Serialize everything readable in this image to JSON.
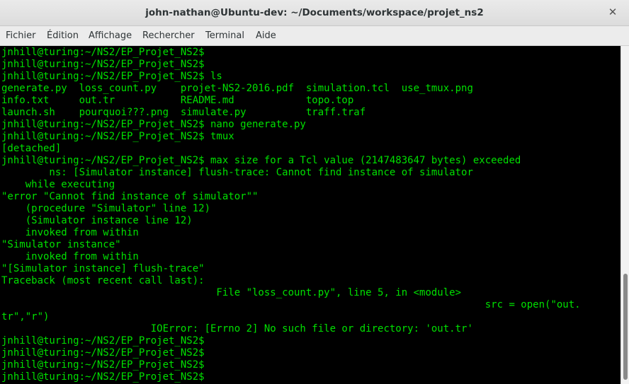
{
  "window": {
    "title": "john-nathan@Ubuntu-dev: ~/Documents/workspace/projet_ns2",
    "close_glyph": "✕"
  },
  "menu": [
    "Fichier",
    "Édition",
    "Affichage",
    "Rechercher",
    "Terminal",
    "Aide"
  ],
  "terminal": {
    "lines": [
      "jnhill@turing:~/NS2/EP_Projet_NS2$",
      "jnhill@turing:~/NS2/EP_Projet_NS2$",
      "jnhill@turing:~/NS2/EP_Projet_NS2$ ls",
      "generate.py  loss_count.py    projet-NS2-2016.pdf  simulation.tcl  use_tmux.png",
      "info.txt     out.tr           README.md            topo.top",
      "launch.sh    pourquoi???.png  simulate.py          traff.traf",
      "jnhill@turing:~/NS2/EP_Projet_NS2$ nano generate.py",
      "jnhill@turing:~/NS2/EP_Projet_NS2$ tmux",
      "[detached]",
      "jnhill@turing:~/NS2/EP_Projet_NS2$ max size for a Tcl value (2147483647 bytes) exceeded",
      "        ns: [Simulator instance] flush-trace: Cannot find instance of simulator",
      "    while executing",
      "\"error \"Cannot find instance of simulator\"\"",
      "    (procedure \"Simulator\" line 12)",
      "    (Simulator instance line 12)",
      "    invoked from within",
      "\"Simulator instance\"",
      "    invoked from within",
      "\"[Simulator instance] flush-trace\"",
      "Traceback (most recent call last):",
      "                                    File \"loss_count.py\", line 5, in <module>",
      "                                                                                 src = open(\"out.",
      "tr\",\"r\")",
      "                         IOError: [Errno 2] No such file or directory: 'out.tr'",
      "jnhill@turing:~/NS2/EP_Projet_NS2$",
      "jnhill@turing:~/NS2/EP_Projet_NS2$",
      "jnhill@turing:~/NS2/EP_Projet_NS2$",
      "jnhill@turing:~/NS2/EP_Projet_NS2$"
    ]
  },
  "colors": {
    "terminal_text": "#00e000",
    "terminal_bg": "#000000"
  }
}
